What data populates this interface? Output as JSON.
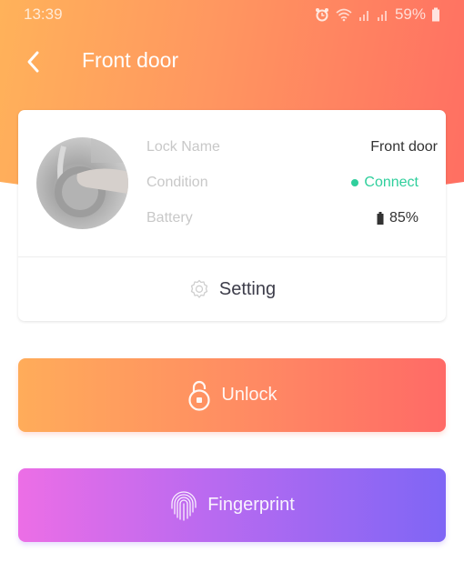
{
  "status_bar": {
    "time": "13:39",
    "icons": [
      "alarm-icon",
      "wifi-icon",
      "signal-icon",
      "signal-icon"
    ],
    "battery_percent": "59%"
  },
  "app_bar": {
    "back_icon": "chevron-left-icon",
    "title": "Front door"
  },
  "lock_card": {
    "avatar": "lock-photo",
    "rows": [
      {
        "label": "Lock Name",
        "value": "Front door"
      },
      {
        "label": "Condition",
        "value": "Connect",
        "status_color": "#2fcf9c"
      },
      {
        "label": "Battery",
        "value": "85%"
      }
    ],
    "setting": {
      "icon": "gear-icon",
      "label": "Setting"
    }
  },
  "actions": {
    "unlock": {
      "icon": "unlock-icon",
      "label": "Unlock"
    },
    "fingerprint": {
      "icon": "fingerprint-icon",
      "label": "Fingerprint"
    }
  },
  "colors": {
    "header_gradient": [
      "#ffb25a",
      "#ff6e62"
    ],
    "unlock_gradient": [
      "#ffac5a",
      "#ff6a66"
    ],
    "fingerprint_gradient": [
      "#ec6ee6",
      "#7f66f5"
    ],
    "connect": "#2fcf9c"
  }
}
